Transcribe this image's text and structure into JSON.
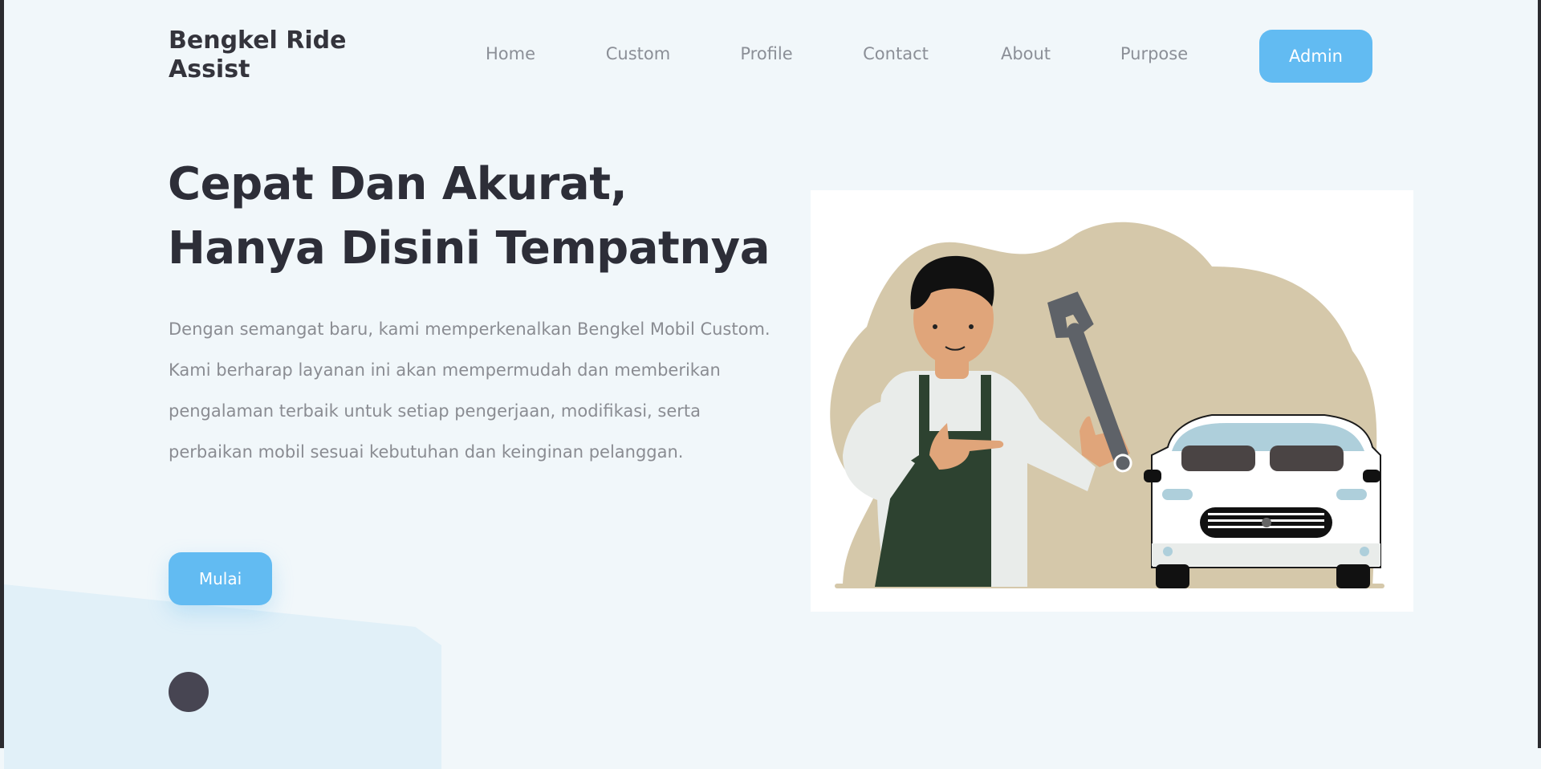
{
  "brand": {
    "name": "Bengkel Ride Assist"
  },
  "nav": {
    "items": [
      {
        "label": "Home"
      },
      {
        "label": "Custom"
      },
      {
        "label": "Profile"
      },
      {
        "label": "Contact"
      },
      {
        "label": "About"
      },
      {
        "label": "Purpose"
      }
    ],
    "admin_label": "Admin"
  },
  "hero": {
    "title_line1": "Cepat Dan Akurat,",
    "title_line2": "Hanya Disini Tempatnya",
    "description": "Dengan semangat baru, kami memperkenalkan Bengkel Mobil Custom. Kami berharap layanan ini akan mempermudah dan memberikan pengalaman terbaik untuk setiap pengerjaan, modifikasi, serta perbaikan mobil sesuai kebutuhan dan keinginan pelanggan.",
    "cta_label": "Mulai"
  },
  "colors": {
    "accent": "#62bbf2",
    "background": "#f1f7fa",
    "heading": "#2d2e38",
    "body_text": "#8a8c92"
  },
  "illustration": {
    "subject": "mechanic-with-wrench-and-car"
  }
}
